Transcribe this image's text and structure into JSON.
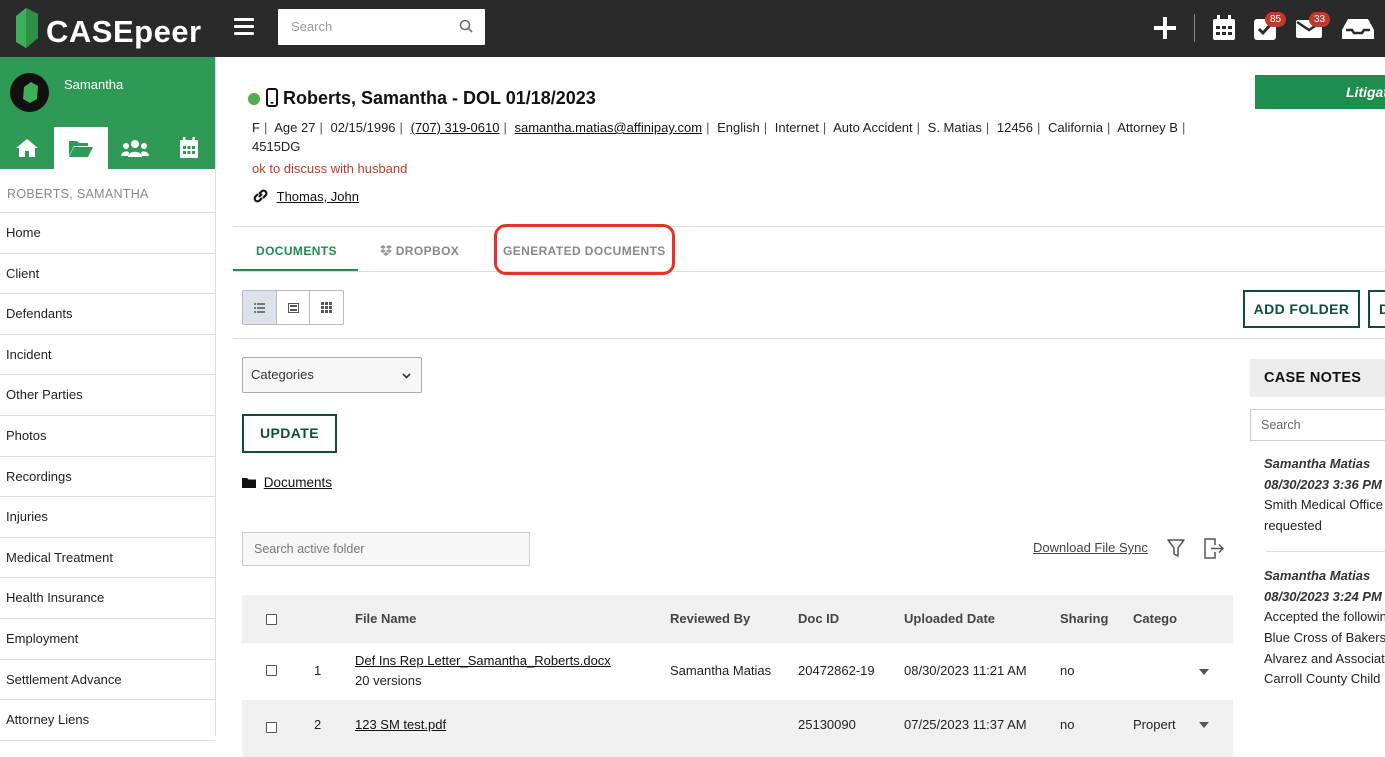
{
  "topbar": {
    "brand": "CASEpeer",
    "search_placeholder": "Search",
    "badges": {
      "tasks": "85",
      "mail": "33"
    },
    "icons": [
      "plus-icon",
      "calendar-icon",
      "tasks-icon",
      "mail-icon",
      "inbox-icon"
    ]
  },
  "sidebar": {
    "user_name": "Samantha",
    "case_name": "ROBERTS, SAMANTHA",
    "items": [
      "Home",
      "Client",
      "Defendants",
      "Incident",
      "Other Parties",
      "Photos",
      "Recordings",
      "Injuries",
      "Medical Treatment",
      "Health Insurance",
      "Employment",
      "Settlement Advance",
      "Attorney Liens"
    ]
  },
  "case": {
    "title": "Roberts, Samantha - DOL 01/18/2023",
    "meta_plain_1": [
      "F",
      "Age 27",
      "02/15/1996"
    ],
    "phone": "(707) 319-0610",
    "email": "samantha.matias@affinipay.com",
    "meta_plain_2": [
      "English",
      "Internet",
      "Auto Accident",
      "S. Matias",
      "12456",
      "California",
      "Attorney B"
    ],
    "meta_tail": "4515DG",
    "note": "ok to discuss with husband",
    "linked_contact": "Thomas, John",
    "stage_button": "Litigation"
  },
  "tabs": [
    {
      "label": "DOCUMENTS",
      "active": true
    },
    {
      "label": "DROPBOX",
      "active": false
    },
    {
      "label": "GENERATED DOCUMENTS",
      "active": false
    }
  ],
  "toolbar": {
    "add_folder": "ADD FOLDER",
    "second_button_initial": "D",
    "categories_label": "Categories",
    "update": "UPDATE",
    "breadcrumb": "Documents",
    "folder_search_placeholder": "Search active folder",
    "download_sync": "Download File Sync"
  },
  "table": {
    "headers": {
      "file_name": "File Name",
      "reviewed_by": "Reviewed By",
      "doc_id": "Doc ID",
      "uploaded": "Uploaded Date",
      "sharing": "Sharing",
      "category": "Catego"
    },
    "rows": [
      {
        "num": "1",
        "file": "Def Ins Rep Letter_Samantha_Roberts.docx",
        "versions": "20 versions",
        "reviewed_by": "Samantha Matias",
        "doc_id": "20472862-19",
        "uploaded": "08/30/2023 11:21 AM",
        "sharing": "no",
        "category": ""
      },
      {
        "num": "2",
        "file": "123 SM test.pdf",
        "versions": "",
        "reviewed_by": "",
        "doc_id": "25130090",
        "uploaded": "07/25/2023 11:37 AM",
        "sharing": "no",
        "category": "Propert"
      }
    ]
  },
  "case_notes": {
    "title": "CASE NOTES",
    "search_placeholder": "Search",
    "notes": [
      {
        "author": "Samantha Matias",
        "time": "08/30/2023 3:36 PM",
        "lines": [
          "Smith Medical Office",
          "requested"
        ]
      },
      {
        "author": "Samantha Matias",
        "time": "08/30/2023 3:24 PM",
        "lines": [
          "Accepted the following",
          "Blue Cross of Bakersfield",
          "Alvarez and Associates",
          "Carroll County Child"
        ]
      }
    ]
  },
  "colors": {
    "brand_green": "#2e9a55",
    "dark_green": "#0d4d3b",
    "highlight_red": "#e53222",
    "topbar": "#2a2a2a"
  }
}
